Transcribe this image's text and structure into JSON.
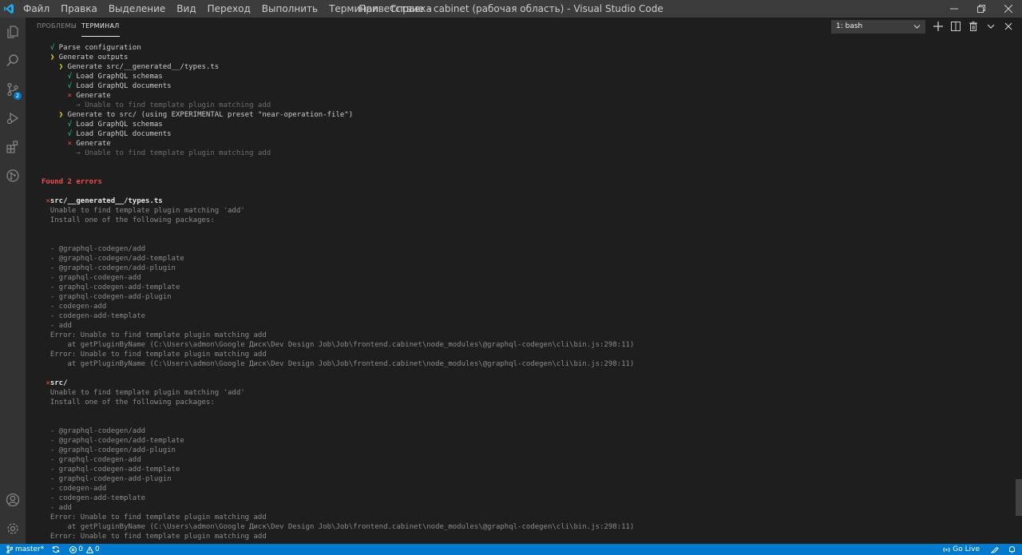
{
  "window": {
    "title": "Приветствие - cabinet (рабочая область) - Visual Studio Code",
    "menu": [
      "Файл",
      "Правка",
      "Выделение",
      "Вид",
      "Переход",
      "Выполнить",
      "Терминал",
      "Справка"
    ]
  },
  "activity_bar": {
    "icons": [
      "files-icon",
      "search-icon",
      "source-control-icon",
      "run-debug-icon",
      "extensions-icon",
      "git-graph-icon",
      "account-icon",
      "settings-gear-icon"
    ],
    "source_control_badge": "2"
  },
  "panel": {
    "tabs": [
      {
        "label": "ПРОБЛЕМЫ",
        "active": false
      },
      {
        "label": "ТЕРМИНАЛ",
        "active": true
      }
    ],
    "terminal_select": "1: bash"
  },
  "terminal": {
    "lines": [
      {
        "p1": "  ",
        "t1": "√",
        "c1": "green",
        "t2": " Parse configuration",
        "c2": "white"
      },
      {
        "p1": "  ",
        "t1": "❯",
        "c1": "yellow",
        "t2": " Generate outputs",
        "c2": "white"
      },
      {
        "p1": "    ",
        "t1": "❯",
        "c1": "yellow",
        "t2": " Generate src/__generated__/types.ts",
        "c2": "white"
      },
      {
        "p1": "      ",
        "t1": "√",
        "c1": "green",
        "t2": " Load GraphQL schemas",
        "c2": "white"
      },
      {
        "p1": "      ",
        "t1": "√",
        "c1": "green",
        "t2": " Load GraphQL documents",
        "c2": "white"
      },
      {
        "p1": "      ",
        "t1": "×",
        "c1": "red",
        "t2": " Generate",
        "c2": "white"
      },
      {
        "p1": "        ",
        "t1": "→ Unable to find template plugin matching add",
        "c1": "faint",
        "t2": "",
        "c2": "white"
      },
      {
        "p1": "    ",
        "t1": "❯",
        "c1": "yellow",
        "t2": " Generate to src/ (using EXPERIMENTAL preset \"near-operation-file\")",
        "c2": "white"
      },
      {
        "p1": "      ",
        "t1": "√",
        "c1": "green",
        "t2": " Load GraphQL schemas",
        "c2": "white"
      },
      {
        "p1": "      ",
        "t1": "√",
        "c1": "green",
        "t2": " Load GraphQL documents",
        "c2": "white"
      },
      {
        "p1": "      ",
        "t1": "×",
        "c1": "red",
        "t2": " Generate",
        "c2": "white"
      },
      {
        "p1": "        ",
        "t1": "→ Unable to find template plugin matching add",
        "c1": "faint",
        "t2": "",
        "c2": "white"
      },
      {
        "p1": "",
        "t1": "",
        "c1": "white",
        "t2": "",
        "c2": "white"
      },
      {
        "p1": "",
        "t1": "",
        "c1": "white",
        "t2": "",
        "c2": "white"
      },
      {
        "p1": "",
        "t1": "Found 2 errors",
        "c1": "bold-red",
        "t2": "",
        "c2": "white"
      },
      {
        "p1": "",
        "t1": "",
        "c1": "white",
        "t2": "",
        "c2": "white"
      },
      {
        "p1": " ",
        "t1": "✕",
        "c1": "red",
        "t2": "src/__generated__/types.ts",
        "c2": "bold"
      },
      {
        "p1": "  ",
        "t1": "Unable to find template plugin matching 'add'",
        "c1": "dim",
        "t2": "",
        "c2": "white"
      },
      {
        "p1": "  ",
        "t1": "Install one of the following packages:",
        "c1": "dim",
        "t2": "",
        "c2": "white"
      },
      {
        "p1": "",
        "t1": "",
        "c1": "white",
        "t2": "",
        "c2": "white"
      },
      {
        "p1": "",
        "t1": "",
        "c1": "white",
        "t2": "",
        "c2": "white"
      },
      {
        "p1": "  ",
        "t1": "- @graphql-codegen/add",
        "c1": "dim",
        "t2": "",
        "c2": "white"
      },
      {
        "p1": "  ",
        "t1": "- @graphql-codegen/add-template",
        "c1": "dim",
        "t2": "",
        "c2": "white"
      },
      {
        "p1": "  ",
        "t1": "- @graphql-codegen/add-plugin",
        "c1": "dim",
        "t2": "",
        "c2": "white"
      },
      {
        "p1": "  ",
        "t1": "- graphql-codegen-add",
        "c1": "dim",
        "t2": "",
        "c2": "white"
      },
      {
        "p1": "  ",
        "t1": "- graphql-codegen-add-template",
        "c1": "dim",
        "t2": "",
        "c2": "white"
      },
      {
        "p1": "  ",
        "t1": "- graphql-codegen-add-plugin",
        "c1": "dim",
        "t2": "",
        "c2": "white"
      },
      {
        "p1": "  ",
        "t1": "- codegen-add",
        "c1": "dim",
        "t2": "",
        "c2": "white"
      },
      {
        "p1": "  ",
        "t1": "- codegen-add-template",
        "c1": "dim",
        "t2": "",
        "c2": "white"
      },
      {
        "p1": "  ",
        "t1": "- add",
        "c1": "dim",
        "t2": "",
        "c2": "white"
      },
      {
        "p1": "  ",
        "t1": "Error: Unable to find template plugin matching add",
        "c1": "dim",
        "t2": "",
        "c2": "white"
      },
      {
        "p1": "      ",
        "t1": "at getPluginByName (C:\\Users\\admon\\Google Диск\\Dev Design Job\\Job\\frontend.cabinet\\node_modules\\@graphql-codegen\\cli\\bin.js:298:11)",
        "c1": "dim",
        "t2": "",
        "c2": "white"
      },
      {
        "p1": "  ",
        "t1": "Error: Unable to find template plugin matching add",
        "c1": "dim",
        "t2": "",
        "c2": "white"
      },
      {
        "p1": "      ",
        "t1": "at getPluginByName (C:\\Users\\admon\\Google Диск\\Dev Design Job\\Job\\frontend.cabinet\\node_modules\\@graphql-codegen\\cli\\bin.js:298:11)",
        "c1": "dim",
        "t2": "",
        "c2": "white"
      },
      {
        "p1": "",
        "t1": "",
        "c1": "white",
        "t2": "",
        "c2": "white"
      },
      {
        "p1": " ",
        "t1": "✕",
        "c1": "red",
        "t2": "src/",
        "c2": "bold"
      },
      {
        "p1": "  ",
        "t1": "Unable to find template plugin matching 'add'",
        "c1": "dim",
        "t2": "",
        "c2": "white"
      },
      {
        "p1": "  ",
        "t1": "Install one of the following packages:",
        "c1": "dim",
        "t2": "",
        "c2": "white"
      },
      {
        "p1": "",
        "t1": "",
        "c1": "white",
        "t2": "",
        "c2": "white"
      },
      {
        "p1": "",
        "t1": "",
        "c1": "white",
        "t2": "",
        "c2": "white"
      },
      {
        "p1": "  ",
        "t1": "- @graphql-codegen/add",
        "c1": "dim",
        "t2": "",
        "c2": "white"
      },
      {
        "p1": "  ",
        "t1": "- @graphql-codegen/add-template",
        "c1": "dim",
        "t2": "",
        "c2": "white"
      },
      {
        "p1": "  ",
        "t1": "- @graphql-codegen/add-plugin",
        "c1": "dim",
        "t2": "",
        "c2": "white"
      },
      {
        "p1": "  ",
        "t1": "- graphql-codegen-add",
        "c1": "dim",
        "t2": "",
        "c2": "white"
      },
      {
        "p1": "  ",
        "t1": "- graphql-codegen-add-template",
        "c1": "dim",
        "t2": "",
        "c2": "white"
      },
      {
        "p1": "  ",
        "t1": "- graphql-codegen-add-plugin",
        "c1": "dim",
        "t2": "",
        "c2": "white"
      },
      {
        "p1": "  ",
        "t1": "- codegen-add",
        "c1": "dim",
        "t2": "",
        "c2": "white"
      },
      {
        "p1": "  ",
        "t1": "- codegen-add-template",
        "c1": "dim",
        "t2": "",
        "c2": "white"
      },
      {
        "p1": "  ",
        "t1": "- add",
        "c1": "dim",
        "t2": "",
        "c2": "white"
      },
      {
        "p1": "  ",
        "t1": "Error: Unable to find template plugin matching add",
        "c1": "dim",
        "t2": "",
        "c2": "white"
      },
      {
        "p1": "      ",
        "t1": "at getPluginByName (C:\\Users\\admon\\Google Диск\\Dev Design Job\\Job\\frontend.cabinet\\node_modules\\@graphql-codegen\\cli\\bin.js:298:11)",
        "c1": "dim",
        "t2": "",
        "c2": "white"
      },
      {
        "p1": "  ",
        "t1": "Error: Unable to find template plugin matching add",
        "c1": "dim",
        "t2": "",
        "c2": "white"
      }
    ]
  },
  "status_bar": {
    "branch": "master*",
    "errors": "0",
    "warnings": "0",
    "go_live": "Go Live"
  },
  "colors": {
    "accent": "#007acc",
    "editor_bg": "#1e1e1e",
    "activity_bar_bg": "#333333",
    "title_bar_bg": "#3c3c3c",
    "success": "#23d18b",
    "warning": "#e5e510",
    "error": "#f14c4c"
  }
}
